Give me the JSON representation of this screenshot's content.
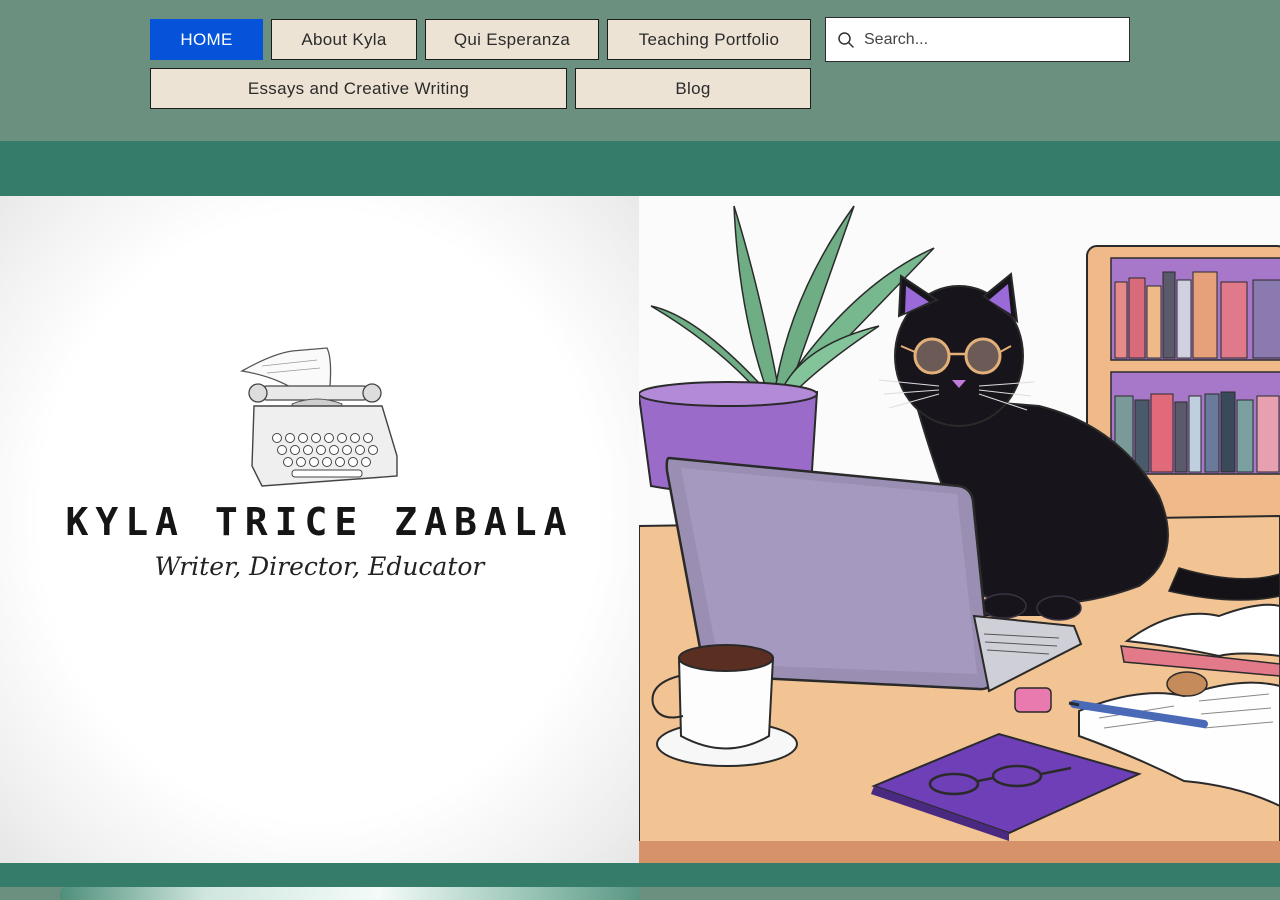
{
  "nav": {
    "items": [
      {
        "label": "HOME",
        "active": true
      },
      {
        "label": "About Kyla",
        "active": false
      },
      {
        "label": "Qui Esperanza",
        "active": false
      },
      {
        "label": "Teaching Portfolio",
        "active": false
      },
      {
        "label": "Essays and Creative Writing",
        "active": false
      },
      {
        "label": "Blog",
        "active": false
      }
    ],
    "active_color": "#0553d9"
  },
  "search": {
    "placeholder": "Search...",
    "icon": "search-icon"
  },
  "hero": {
    "logo": {
      "name": "KYLA TRICE ZABALA",
      "tagline": "Writer, Director, Educator",
      "icon": "typewriter-icon"
    },
    "illustration": "black cat with glasses at desk with laptop, coffee, books and plant"
  },
  "colors": {
    "header_bg": "#6b9080",
    "band": "#357d6a",
    "nav_button": "#ede3d4"
  }
}
